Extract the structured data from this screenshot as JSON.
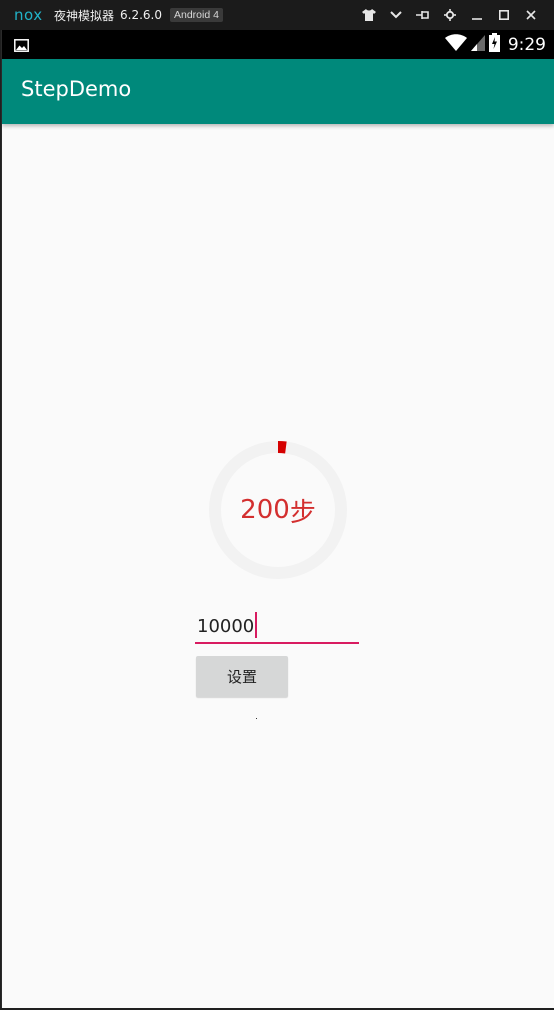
{
  "emulator": {
    "logo_text": "nox",
    "title": "夜神模拟器",
    "version": "6.2.6.0",
    "badge": "Android 4",
    "controls": [
      "shirt-icon",
      "dropdown-icon",
      "pin-icon",
      "settings-icon",
      "minimize-icon",
      "maximize-icon",
      "close-icon"
    ]
  },
  "status_bar": {
    "time": "9:29",
    "icons": [
      "image-notification-icon",
      "wifi-icon",
      "signal-icon",
      "battery-icon"
    ]
  },
  "app": {
    "title": "StepDemo",
    "theme_color": "#00897b"
  },
  "step_ring": {
    "value": "200",
    "unit": "步",
    "progress_fraction": 0.02,
    "progress_color": "#d50000",
    "track_color": "#f2f2f2",
    "text_color": "#d32f2f"
  },
  "goal_input": {
    "value": "10000",
    "underline_color": "#d81b60"
  },
  "set_button": {
    "label": "设置"
  }
}
